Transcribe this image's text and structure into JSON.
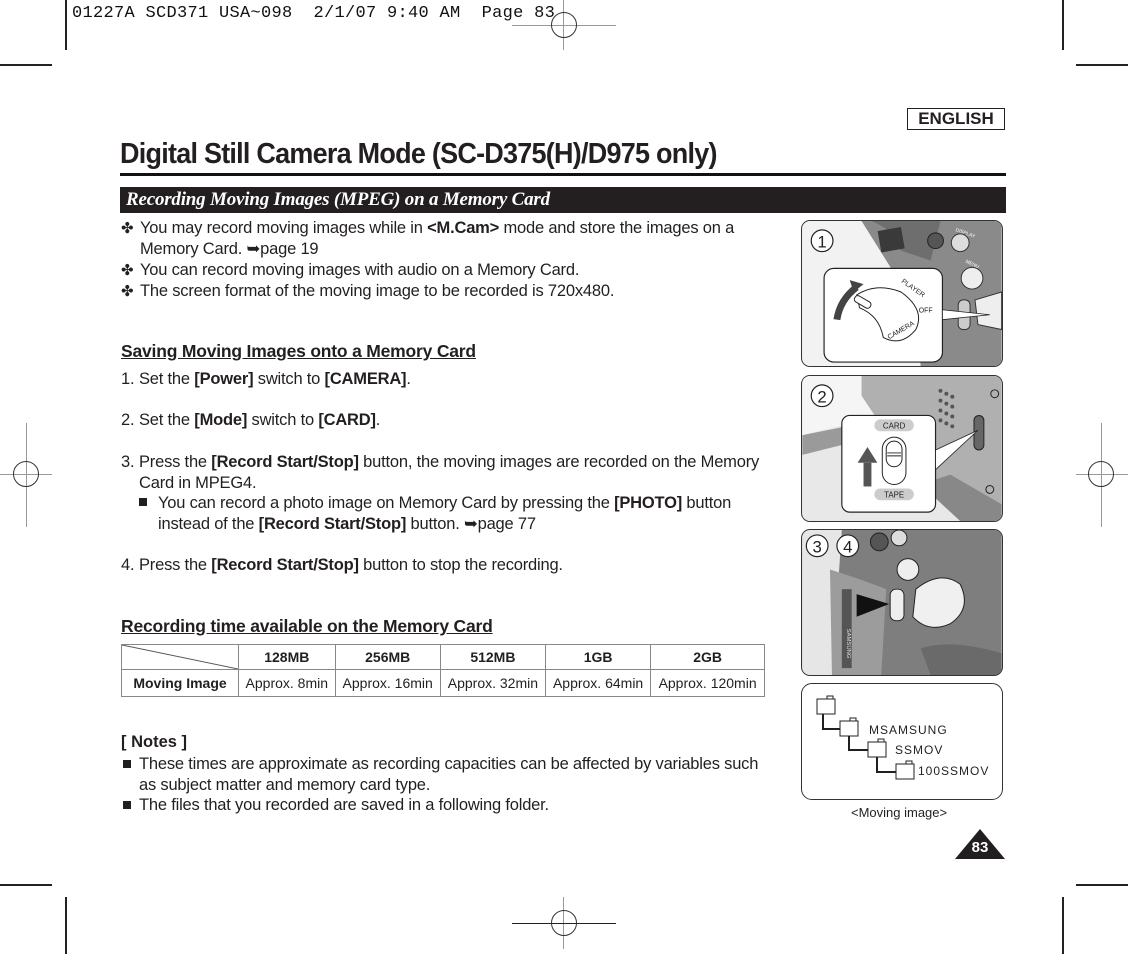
{
  "print_header": {
    "text": "01227A SCD371 USA~098  2/1/07 9:40 AM  Page 83"
  },
  "language_badge": "ENGLISH",
  "page_title": "Digital Still Camera Mode (SC-D375(H)/D975 only)",
  "section_title": "Recording Moving Images (MPEG) on a Memory Card",
  "intro": {
    "bullet_glyph": "✤",
    "items": [
      {
        "before": "You may record moving images while in ",
        "bold": "<M.Cam>",
        "after": " mode and store the images on a Memory Card. ",
        "ref_arrow": "➥",
        "ref": "page 19"
      },
      {
        "text": "You can record moving images with audio on a Memory Card."
      },
      {
        "text": "The screen format of the moving image to be recorded is 720x480."
      }
    ]
  },
  "saving": {
    "heading": "Saving Moving Images onto a Memory Card",
    "steps": [
      {
        "num": "1.",
        "parts": [
          [
            "Set the ",
            false
          ],
          [
            "[Power]",
            true
          ],
          [
            " switch to ",
            false
          ],
          [
            "[CAMERA]",
            true
          ],
          [
            ".",
            false
          ]
        ]
      },
      {
        "num": "2.",
        "parts": [
          [
            "Set the ",
            false
          ],
          [
            "[Mode]",
            true
          ],
          [
            " switch to ",
            false
          ],
          [
            "[CARD]",
            true
          ],
          [
            ".",
            false
          ]
        ]
      },
      {
        "num": "3.",
        "parts": [
          [
            "Press the ",
            false
          ],
          [
            "[Record Start/Stop]",
            true
          ],
          [
            " button, the moving images are recorded on the Memory Card in MPEG4.",
            false
          ]
        ]
      },
      {
        "num": "4.",
        "parts": [
          [
            "Press the ",
            false
          ],
          [
            "[Record Start/Stop]",
            true
          ],
          [
            " button to stop the recording.",
            false
          ]
        ]
      }
    ],
    "step3_sub": {
      "parts": [
        [
          "You can record a photo image on Memory Card by pressing the ",
          false
        ],
        [
          "[PHOTO]",
          true
        ],
        [
          " button instead of the ",
          false
        ],
        [
          "[Record Start/Stop]",
          true
        ],
        [
          " button. ",
          false
        ],
        [
          "➥",
          false
        ],
        [
          "page 77",
          false
        ]
      ]
    }
  },
  "recording_time": {
    "heading": "Recording time available on the Memory Card",
    "columns": [
      "128MB",
      "256MB",
      "512MB",
      "1GB",
      "2GB"
    ],
    "rows": [
      {
        "label": "Moving Image",
        "values": [
          "Approx. 8min",
          "Approx. 16min",
          "Approx. 32min",
          "Approx. 64min",
          "Approx. 120min"
        ]
      }
    ]
  },
  "notes": {
    "title": "[ Notes ]",
    "items": [
      "These times are approximate as recording capacities can be affected by variables such as subject matter and memory card type.",
      "The files that you recorded are saved in a following folder."
    ]
  },
  "illustrations": [
    {
      "step_labels": [
        "1"
      ],
      "labels": {
        "player": "PLAYER",
        "off": "OFF",
        "camera": "CAMERA",
        "display": "DISPLAY",
        "menu": "MENU"
      }
    },
    {
      "step_labels": [
        "2"
      ],
      "labels": {
        "card": "CARD",
        "tape": "TAPE"
      }
    },
    {
      "step_labels": [
        "3",
        "4"
      ],
      "labels": {
        "brand": "SAMSUNG"
      }
    }
  ],
  "folder_tree": {
    "folders": [
      "MSAMSUNG",
      "SSMOV",
      "100SSMOV"
    ],
    "caption": "<Moving image>"
  },
  "page_number": "83"
}
